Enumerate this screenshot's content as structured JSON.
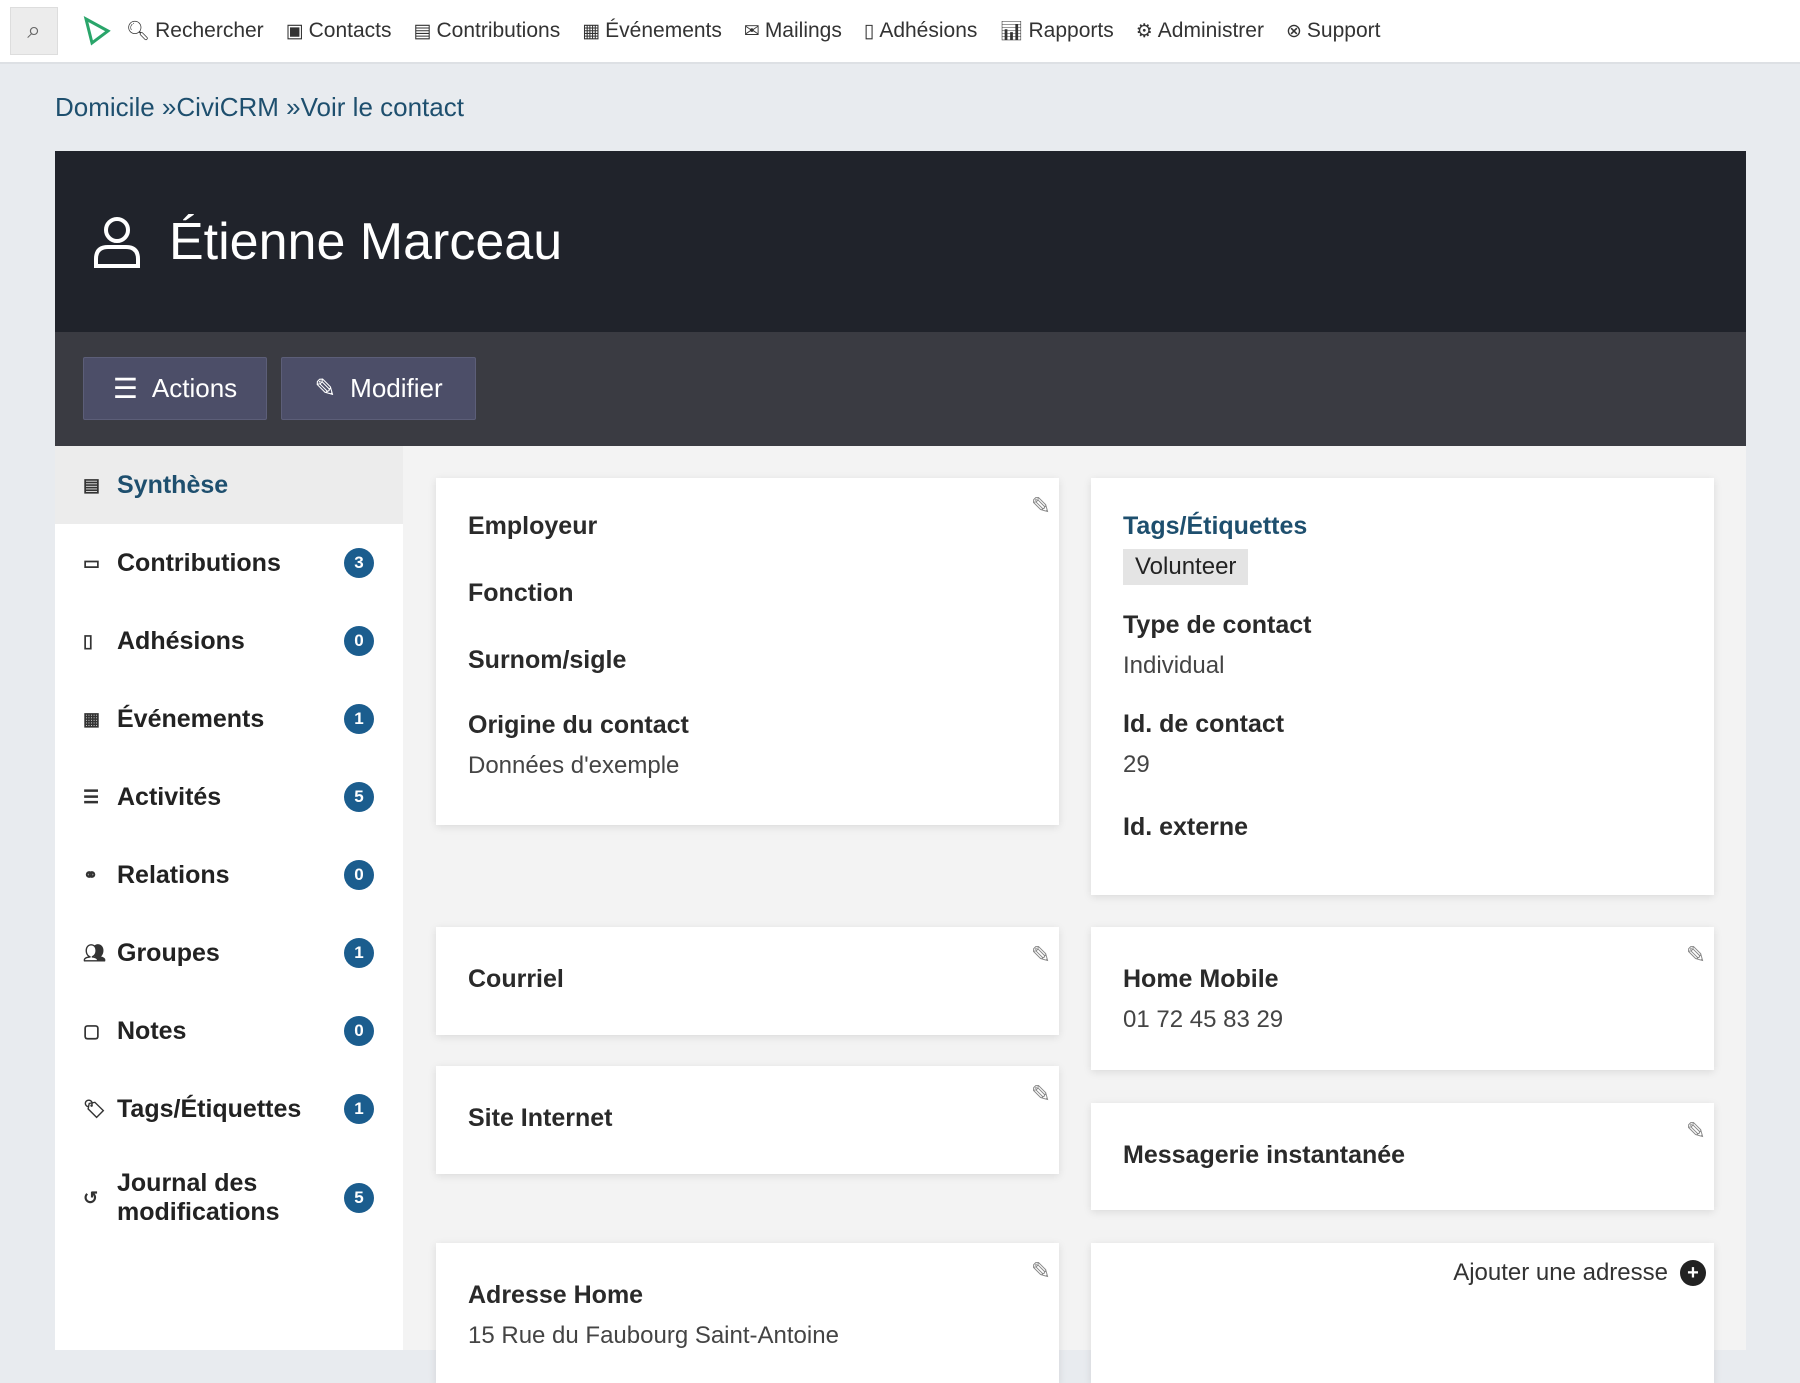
{
  "nav": {
    "items": [
      {
        "label": "Rechercher",
        "icon": "search-icon",
        "glyph": "🔍︎"
      },
      {
        "label": "Contacts",
        "icon": "contact-card-icon",
        "glyph": "▣"
      },
      {
        "label": "Contributions",
        "icon": "credit-card-icon",
        "glyph": "▤"
      },
      {
        "label": "Événements",
        "icon": "calendar-icon",
        "glyph": "▦"
      },
      {
        "label": "Mailings",
        "icon": "envelope-icon",
        "glyph": "✉"
      },
      {
        "label": "Adhésions",
        "icon": "id-badge-icon",
        "glyph": "▯"
      },
      {
        "label": "Rapports",
        "icon": "bar-chart-icon",
        "glyph": "📊︎"
      },
      {
        "label": "Administrer",
        "icon": "gears-icon",
        "glyph": "⚙"
      },
      {
        "label": "Support",
        "icon": "life-ring-icon",
        "glyph": "⊗"
      }
    ]
  },
  "breadcrumb": [
    "Domicile",
    "CiviCRM",
    "Voir le contact"
  ],
  "contact": {
    "name": "Étienne Marceau"
  },
  "actions": {
    "actions_label": "Actions",
    "edit_label": "Modifier"
  },
  "sidebar": {
    "items": [
      {
        "label": "Synthèse",
        "glyph": "▤",
        "count": null
      },
      {
        "label": "Contributions",
        "glyph": "▭",
        "count": "3"
      },
      {
        "label": "Adhésions",
        "glyph": "▯",
        "count": "0"
      },
      {
        "label": "Événements",
        "glyph": "▦",
        "count": "1"
      },
      {
        "label": "Activités",
        "glyph": "☰",
        "count": "5"
      },
      {
        "label": "Relations",
        "glyph": "⚭",
        "count": "0"
      },
      {
        "label": "Groupes",
        "glyph": "👥︎",
        "count": "1"
      },
      {
        "label": "Notes",
        "glyph": "▢",
        "count": "0"
      },
      {
        "label": "Tags/Étiquettes",
        "glyph": "🏷︎",
        "count": "1"
      },
      {
        "label": "Journal des modifications",
        "glyph": "↺",
        "count": "5"
      }
    ]
  },
  "summary": {
    "employer": "Employeur",
    "job": "Fonction",
    "nickname": "Surnom/sigle",
    "source_label": "Origine du contact",
    "source_value": "Données d'exemple"
  },
  "tags": {
    "title": "Tags/Étiquettes",
    "tag": "Volunteer",
    "type_label": "Type de contact",
    "type_value": "Individual",
    "id_label": "Id. de contact",
    "id_value": "29",
    "ext_label": "Id. externe"
  },
  "email": {
    "label": "Courriel"
  },
  "phone": {
    "label": "Home Mobile",
    "value": "01 72 45 83 29"
  },
  "website": {
    "label": "Site Internet"
  },
  "im": {
    "label": "Messagerie instantanée"
  },
  "address": {
    "label": "Adresse Home",
    "line1": "15 Rue du Faubourg Saint-Antoine",
    "add_label": "Ajouter une adresse"
  }
}
